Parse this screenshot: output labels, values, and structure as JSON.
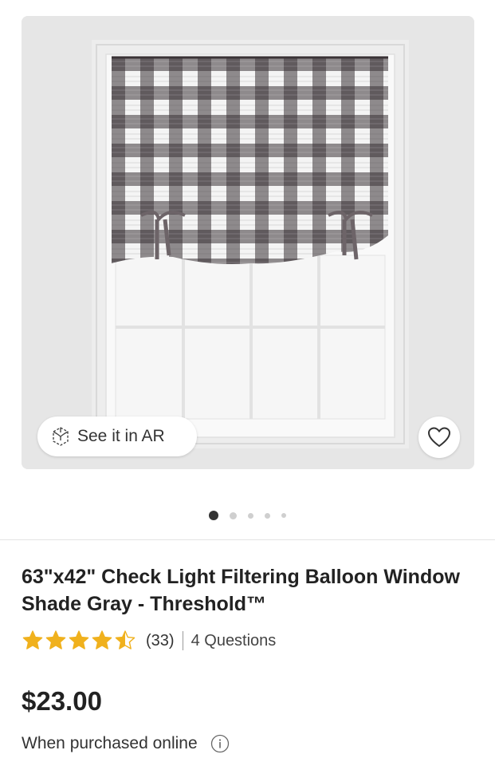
{
  "gallery": {
    "image_alt": "product-photo",
    "ar_label": "See it in AR",
    "ar_icon": "ar-cube-icon",
    "favorite_icon": "heart-icon",
    "dots_total": 5,
    "dots_active": 1
  },
  "product": {
    "title": "63\"x42\" Check Light Filtering Balloon Window Shade Gray - Threshold™",
    "rating": 4.5,
    "rating_max": 5,
    "review_count": "(33)",
    "questions": "4 Questions",
    "price": "$23.00",
    "purchase_note": "When purchased online",
    "info_icon": "info-icon"
  },
  "colors": {
    "star": "#f0b11d",
    "plaid_dark": "#3a3336",
    "background": "#e6e6e6"
  }
}
